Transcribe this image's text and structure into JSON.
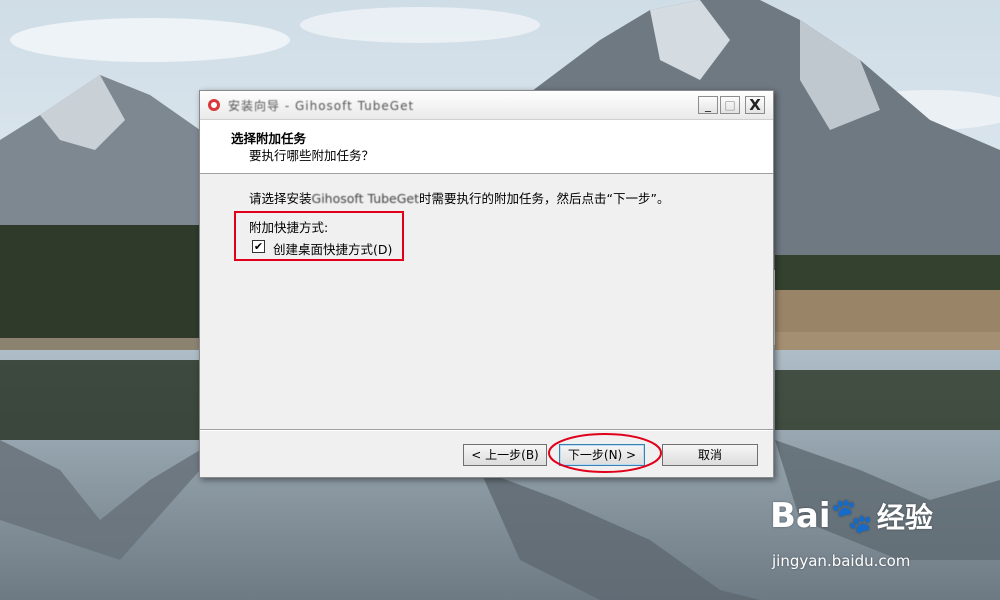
{
  "window": {
    "title": "安装向导 - Gihosoft TubeGet",
    "minimize_label": "_",
    "maximize_label": "□",
    "close_label": "X"
  },
  "header": {
    "title": "选择附加任务",
    "subtitle": "要执行哪些附加任务？"
  },
  "body": {
    "instruction_prefix": "请选择安装",
    "instruction_app": "Gihosoft TubeGet",
    "instruction_suffix": "时需要执行的附加任务，然后点击“下一步”。",
    "group_label": "附加快捷方式:",
    "checkbox_label": "创建桌面快捷方式(D)",
    "checkbox_mark": "✔",
    "checkbox_checked": true
  },
  "buttons": {
    "back": "< 上一步(B)",
    "next": "下一步(N) >",
    "cancel": "取消"
  },
  "watermark": {
    "logo_text": "Bai",
    "logo_text2": "经验",
    "url": "jingyan.baidu.com"
  },
  "colors": {
    "highlight": "#e0001a",
    "window_bg": "#f0f0f0"
  }
}
